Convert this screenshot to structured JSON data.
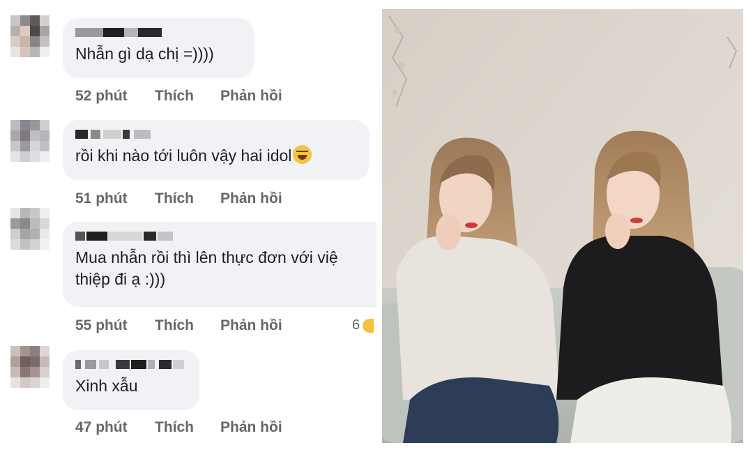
{
  "comments": [
    {
      "text": "Nhẫn gì dạ chị =))))",
      "time": "52 phút",
      "like": "Thích",
      "reply": "Phản hồi",
      "reactions": ""
    },
    {
      "text": "rồi khi nào tới luôn vậy hai idol",
      "time": "51 phút",
      "like": "Thích",
      "reply": "Phản hồi",
      "reactions": ""
    },
    {
      "text_line1": "Mua nhẫn rồi thì lên thực đơn với việ",
      "text_line2": "thiệp đi ạ :)))",
      "time": "55 phút",
      "like": "Thích",
      "reply": "Phản hồi",
      "reactions": "6"
    },
    {
      "text": "Xinh xẫu",
      "time": "47 phút",
      "like": "Thích",
      "reply": "Phản hồi",
      "reactions": ""
    }
  ],
  "emojis": {
    "comment2": "rolling-on-floor-laughing-icon",
    "comment3_reaction": "haha-reaction-icon"
  },
  "colors": {
    "bubble": "#f0f2f5",
    "meta_text": "#65676b",
    "body_text": "#1c1e21"
  }
}
